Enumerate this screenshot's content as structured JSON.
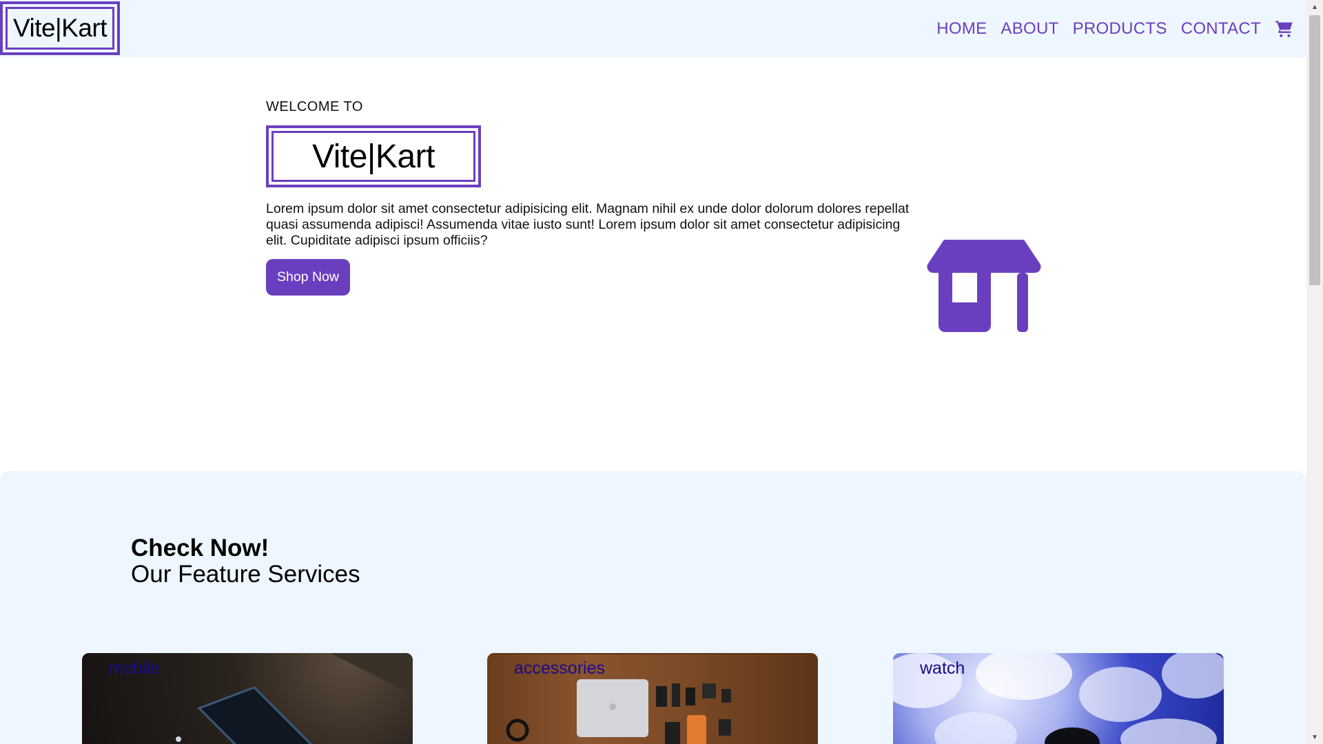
{
  "header": {
    "logo": "Vite|Kart",
    "nav": [
      {
        "label": "HOME"
      },
      {
        "label": "ABOUT"
      },
      {
        "label": "PRODUCTS"
      },
      {
        "label": "CONTACT"
      }
    ],
    "cart_icon": "cart-icon"
  },
  "hero": {
    "welcome": "WELCOME TO",
    "logo": "Vite|Kart",
    "description": "Lorem ipsum dolor sit amet consectetur adipisicing elit. Magnam nihil ex unde dolor dolorum dolores repellat quasi assumenda adipisci! Assumenda vitae iusto sunt! Lorem ipsum dolor sit amet consectetur adipisicing elit. Cupiditate adipisci ipsum officiis?",
    "button": "Shop Now",
    "icon": "store-icon"
  },
  "feature": {
    "title": "Check Now!",
    "subtitle": "Our Feature Services",
    "cards": [
      {
        "label": "mobile"
      },
      {
        "label": "accessories"
      },
      {
        "label": "watch"
      }
    ]
  },
  "colors": {
    "accent": "#6a3fbf",
    "header_bg": "#eef6ff",
    "card_label": "#1a0a8c"
  }
}
